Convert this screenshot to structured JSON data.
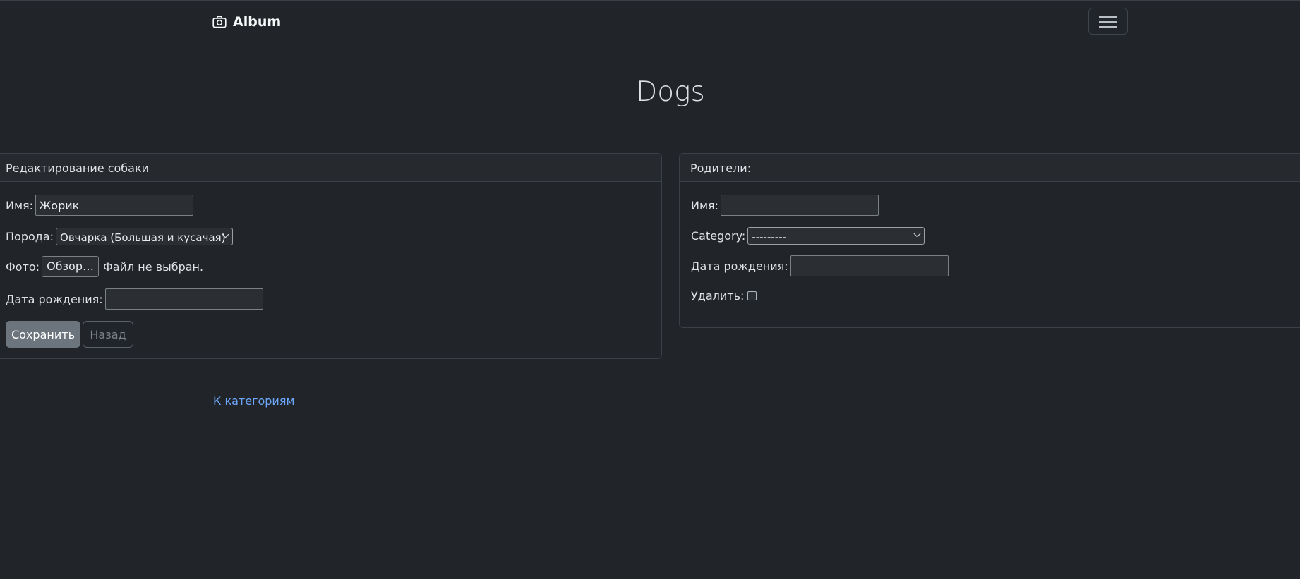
{
  "navbar": {
    "brand": "Album",
    "brand_icon": "camera-icon",
    "toggler_icon": "hamburger-menu-icon"
  },
  "page": {
    "title": "Dogs"
  },
  "edit_card": {
    "header": "Редактирование собаки",
    "name_label": "Имя:",
    "name_value": "Жорик",
    "breed_label": "Порода:",
    "breed_selected": "Овчарка (Большая и кусачая)",
    "photo_label": "Фото:",
    "photo_button": "Обзор…",
    "photo_status": "Файл не выбран.",
    "birth_label": "Дата рождения:",
    "birth_value": "",
    "save_button": "Сохранить",
    "back_button": "Назад"
  },
  "parents_card": {
    "header": "Родители:",
    "name_label": "Имя:",
    "name_value": "",
    "category_label": "Category:",
    "category_selected": "---------",
    "birth_label": "Дата рождения:",
    "birth_value": "",
    "delete_label": "Удалить:",
    "delete_checked": false
  },
  "footer_link": "К категориям",
  "colors": {
    "background": "#212529",
    "link": "#6ea8fe",
    "save_button": "#6c757d"
  }
}
